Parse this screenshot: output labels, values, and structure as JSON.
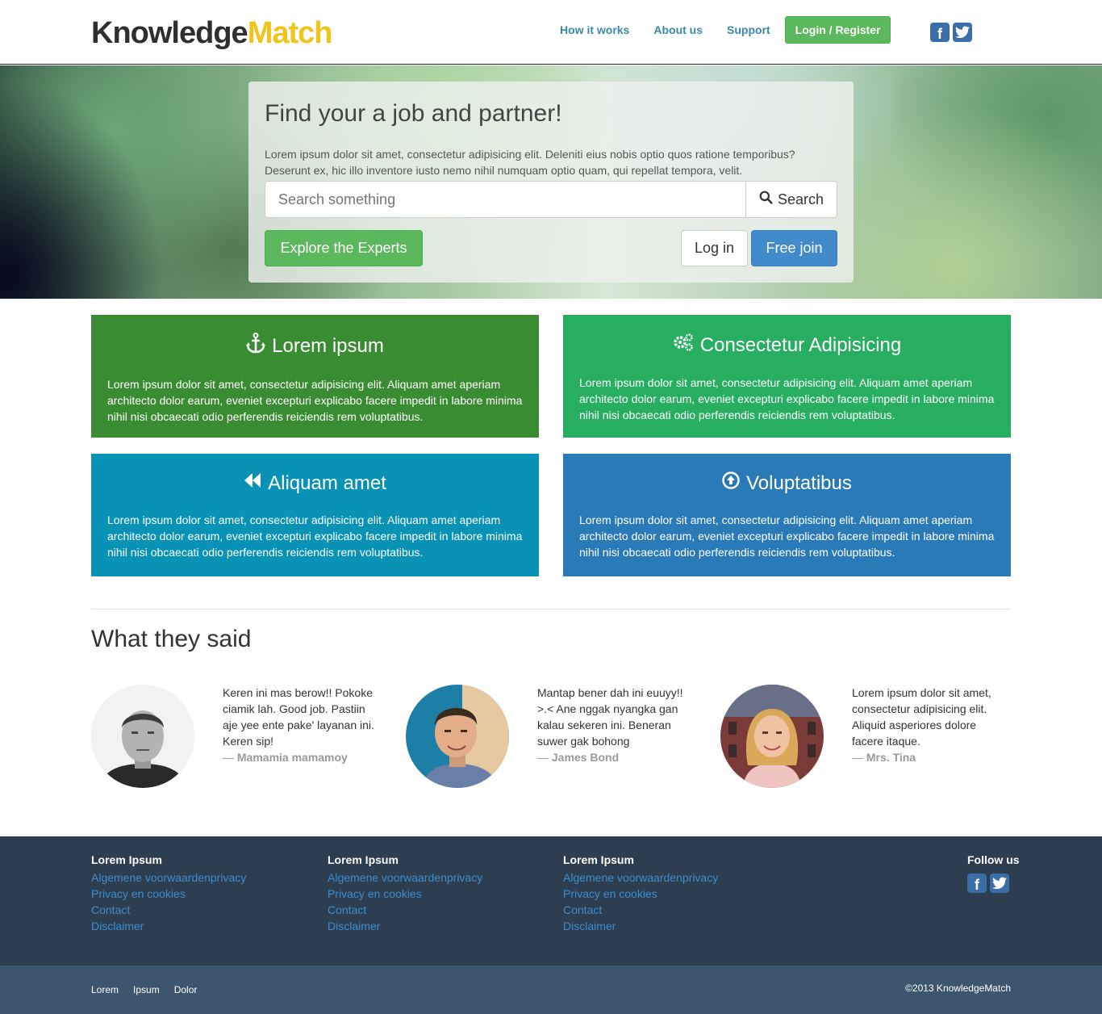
{
  "header": {
    "logo_part1": "Knowledge",
    "logo_part2": "Match",
    "nav": [
      "How it works",
      "About us",
      "Support"
    ],
    "login_label": "Login / Register",
    "social": [
      "facebook-icon",
      "twitter-icon"
    ]
  },
  "hero": {
    "title": "Find your a job and partner!",
    "text": "Lorem ipsum dolor sit amet, consectetur adipisicing elit. Deleniti eius nobis optio quos ratione temporibus? Deserunt ex, hic illo inventore iusto nemo nihil numquam optio quam, qui repellat tempora, velit.",
    "search_placeholder": "Search something",
    "search_button": "Search",
    "explore_button": "Explore the Experts",
    "login_button": "Log in",
    "join_button": "Free join"
  },
  "features": [
    {
      "title": "Lorem ipsum",
      "icon": "anchor-icon",
      "color": "#3a8c32",
      "text": "Lorem ipsum dolor sit amet, consectetur adipisicing elit. Aliquam amet aperiam architecto dolor earum, eveniet excepturi explicabo facere impedit in labore minima nihil nisi obcaecati odio perferendis reiciendis rem voluptatibus."
    },
    {
      "title": "Consectetur Adipisicing",
      "icon": "gears-icon",
      "color": "#27ae60",
      "text": "Lorem ipsum dolor sit amet, consectetur adipisicing elit. Aliquam amet aperiam architecto dolor earum, eveniet excepturi explicabo facere impedit in labore minima nihil nisi obcaecati odio perferendis reiciendis rem voluptatibus."
    },
    {
      "title": "Aliquam amet",
      "icon": "backward-icon",
      "color": "#0892b5",
      "text": "Lorem ipsum dolor sit amet, consectetur adipisicing elit. Aliquam amet aperiam architecto dolor earum, eveniet excepturi explicabo facere impedit in labore minima nihil nisi obcaecati odio perferendis reiciendis rem voluptatibus."
    },
    {
      "title": "Voluptatibus",
      "icon": "circle-arrow-up-icon",
      "color": "#2a7ab7",
      "text": "Lorem ipsum dolor sit amet, consectetur adipisicing elit. Aliquam amet aperiam architecto dolor earum, eveniet excepturi explicabo facere impedit in labore minima nihil nisi obcaecati odio perferendis reiciendis rem voluptatibus."
    }
  ],
  "testimonials": {
    "title": "What they said",
    "items": [
      {
        "quote": "Keren ini mas berow!! Pokoke ciamik lah. Good job. Pastiin aje yee ente pake' layanan ini. Keren sip!",
        "author": "Mamamia mamamoy"
      },
      {
        "quote": "Mantap bener dah ini euuyy!! >.< Ane nggak nyangka gan kalau sekeren ini. Beneran suwer gak bohong",
        "author": "James Bond"
      },
      {
        "quote": "Lorem ipsum dolor sit amet, consectetur adipisicing elit. Aliquid asperiores dolore facere itaque.",
        "author": "Mrs. Tina"
      }
    ]
  },
  "footer": {
    "columns": [
      {
        "title": "Lorem Ipsum",
        "links": [
          "Algemene voorwaardenprivacy",
          "Privacy en cookies",
          "Contact",
          "Disclaimer"
        ]
      },
      {
        "title": "Lorem Ipsum",
        "links": [
          "Algemene voorwaardenprivacy",
          "Privacy en cookies",
          "Contact",
          "Disclaimer"
        ]
      },
      {
        "title": "Lorem Ipsum",
        "links": [
          "Algemene voorwaardenprivacy",
          "Privacy en cookies",
          "Contact",
          "Disclaimer"
        ]
      }
    ],
    "follow_title": "Follow us",
    "sub_links": [
      "Lorem",
      "Ipsum",
      "Dolor"
    ],
    "copyright": "©2013 KnowledgeMatch"
  }
}
